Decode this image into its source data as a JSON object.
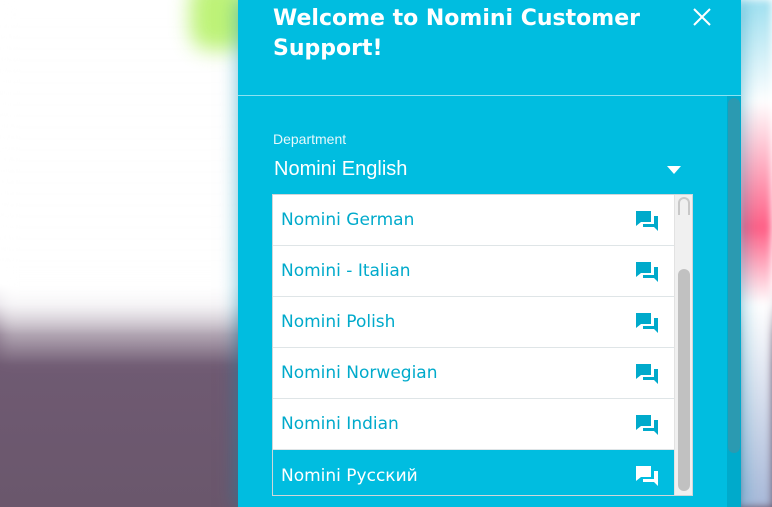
{
  "widget": {
    "title": "Welcome to Nomini Customer Support!",
    "close_icon": "close-icon"
  },
  "department": {
    "label": "Department",
    "selected_value": "Nomini English",
    "options": [
      {
        "label": "Nomini German",
        "icon": "chat-icon"
      },
      {
        "label": "Nomini - Italian",
        "icon": "chat-icon"
      },
      {
        "label": "Nomini Polish",
        "icon": "chat-icon"
      },
      {
        "label": "Nomini Norwegian",
        "icon": "chat-icon"
      },
      {
        "label": "Nomini Indian",
        "icon": "chat-icon"
      },
      {
        "label": "Nomini Русский",
        "icon": "chat-icon",
        "highlighted": true
      }
    ]
  },
  "colors": {
    "panel": "#00bde0",
    "option_text": "#00aacb",
    "highlight": "#00bde0"
  }
}
